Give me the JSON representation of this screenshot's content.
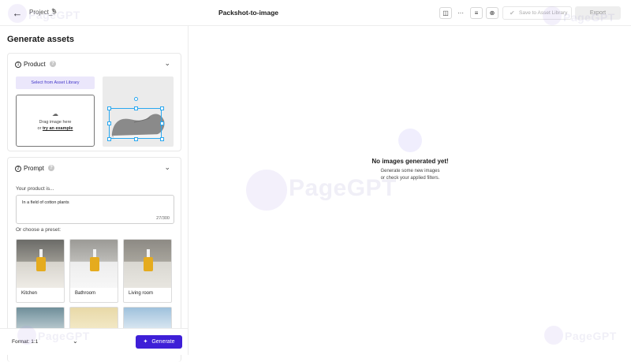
{
  "header": {
    "project_name": "Project_5",
    "title": "Packshot-to-image",
    "save_label": "Save to Asset Library",
    "export_label": "Export",
    "icons": [
      "back-arrow-icon",
      "pencil-icon",
      "split-view-icon",
      "more-icon",
      "sliders-icon",
      "crosshair-icon",
      "check-circle-icon"
    ]
  },
  "left": {
    "title": "Generate assets",
    "product": {
      "step": "1",
      "title": "Product",
      "select_label": "Select from Asset Library",
      "drop_line1": "Drag image here",
      "drop_or": "or",
      "drop_link": "try an example"
    },
    "prompt": {
      "step": "2",
      "title": "Prompt",
      "field_label": "Your product is...",
      "value": "In a field of cotton plants",
      "count": "27/300",
      "preset_label": "Or choose a preset:",
      "presets": [
        {
          "name": "Kitchen"
        },
        {
          "name": "Bathroom"
        },
        {
          "name": "Living room"
        }
      ]
    },
    "footer": {
      "format_label": "Format: 1:1",
      "generate_label": "Generate"
    }
  },
  "main": {
    "empty_title": "No images generated yet!",
    "empty_line1": "Generate some new images",
    "empty_line2": "or check your applied filters."
  },
  "watermark": "PageGPT",
  "colors": {
    "accent": "#3e1fd7",
    "accent_light": "#ebe7fb",
    "selection": "#2aa8f0"
  }
}
